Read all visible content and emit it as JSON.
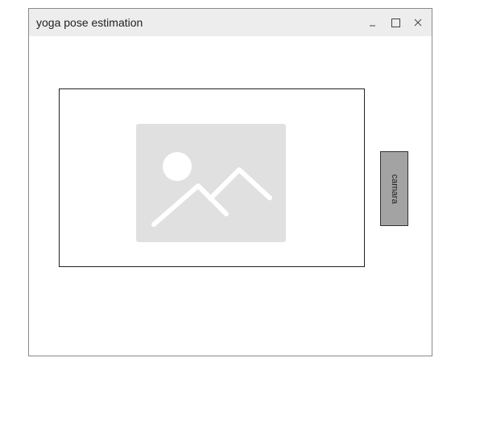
{
  "window": {
    "title": "yoga pose estimation",
    "controls": {
      "minimize_icon": "minimize-icon",
      "maximize_icon": "maximize-icon",
      "close_icon": "close-icon"
    }
  },
  "main": {
    "image_placeholder_icon": "image-placeholder-icon",
    "camera_button_label": "camara"
  },
  "colors": {
    "titlebar_bg": "#ededed",
    "placeholder_bg": "#e0e0e0",
    "button_bg": "#a3a3a3"
  }
}
